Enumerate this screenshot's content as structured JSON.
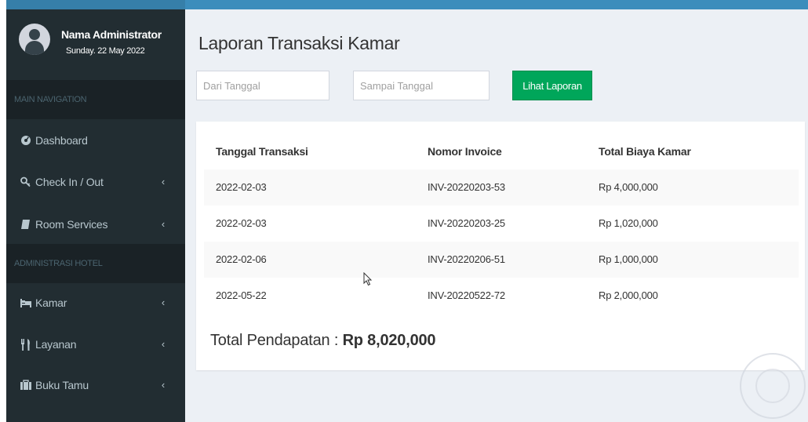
{
  "user": {
    "name": "Nama Administrator",
    "date": "Sunday. 22 May 2022"
  },
  "sidebar": {
    "main_nav_header": "MAIN NAVIGATION",
    "main_items": [
      {
        "label": "Dashboard",
        "icon": "dashboard-icon",
        "has_chevron": false
      },
      {
        "label": "Check In / Out",
        "icon": "key-icon",
        "has_chevron": true
      },
      {
        "label": "Room Services",
        "icon": "book-icon",
        "has_chevron": true
      }
    ],
    "admin_header": "ADMINISTRASI HOTEL",
    "admin_items": [
      {
        "label": "Kamar",
        "icon": "bed-icon",
        "has_chevron": true
      },
      {
        "label": "Layanan",
        "icon": "cutlery-icon",
        "has_chevron": true
      },
      {
        "label": "Buku Tamu",
        "icon": "suitcase-icon",
        "has_chevron": true
      }
    ],
    "chevron": "‹"
  },
  "page": {
    "title": "Laporan Transaksi Kamar",
    "from_placeholder": "Dari Tanggal",
    "to_placeholder": "Sampai Tanggal",
    "button_label": "Lihat Laporan"
  },
  "table": {
    "headers": [
      "Tanggal Transaksi",
      "Nomor Invoice",
      "Total Biaya Kamar"
    ],
    "rows": [
      [
        "2022-02-03",
        "INV-20220203-53",
        "Rp 4,000,000"
      ],
      [
        "2022-02-03",
        "INV-20220203-25",
        "Rp 1,020,000"
      ],
      [
        "2022-02-06",
        "INV-20220206-51",
        "Rp 1,000,000"
      ],
      [
        "2022-05-22",
        "INV-20220522-72",
        "Rp 2,000,000"
      ]
    ]
  },
  "total": {
    "label": "Total Pendapatan : ",
    "value": "Rp 8,020,000"
  },
  "colors": {
    "header_bar": "#3c8dbc",
    "sidebar_bg": "#222d32",
    "button_green": "#00a65a",
    "content_bg": "#ecf0f5"
  }
}
